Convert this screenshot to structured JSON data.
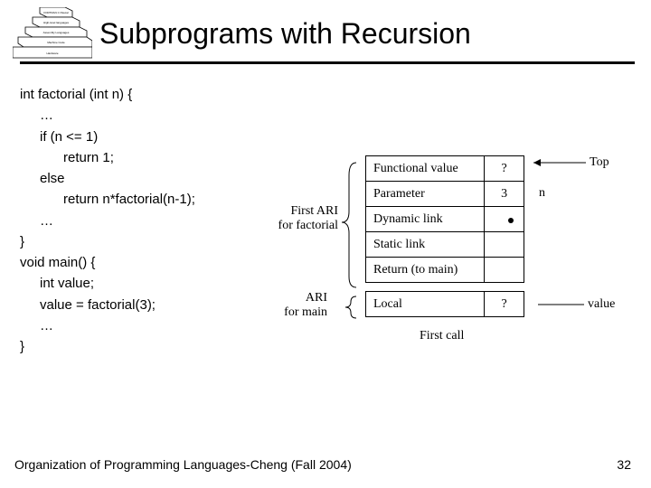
{
  "header": {
    "title": "Subprograms with Recursion"
  },
  "code": {
    "l1": "int factorial (int n) {",
    "l2": "…",
    "l3": "if (n <= 1)",
    "l4": "return 1;",
    "l5": "else",
    "l6": "return n*factorial(n-1);",
    "l7": "…",
    "l8": "}",
    "l9": "void main() {",
    "l10": "int value;",
    "l11": "value = factorial(3);",
    "l12": "…",
    "l13": "}"
  },
  "diagram": {
    "left1_line1": "First ARI",
    "left1_line2": "for factorial",
    "left2_line1": "ARI",
    "left2_line2": "for main",
    "rows": {
      "r1c1": "Functional value",
      "r1c2": "?",
      "r2c1": "Parameter",
      "r2c2": "3",
      "r3c1": "Dynamic link",
      "r3c2": "",
      "r4c1": "Static link",
      "r4c2": "",
      "r5c1": "Return (to main)",
      "r5c2": "",
      "r6c1": "Local",
      "r6c2": "?"
    },
    "right_top": "Top",
    "right_n": "n",
    "right_value": "value",
    "caption": "First call"
  },
  "footer": {
    "left": "Organization of Programming Languages-Cheng (Fall 2004)",
    "right": "32"
  }
}
